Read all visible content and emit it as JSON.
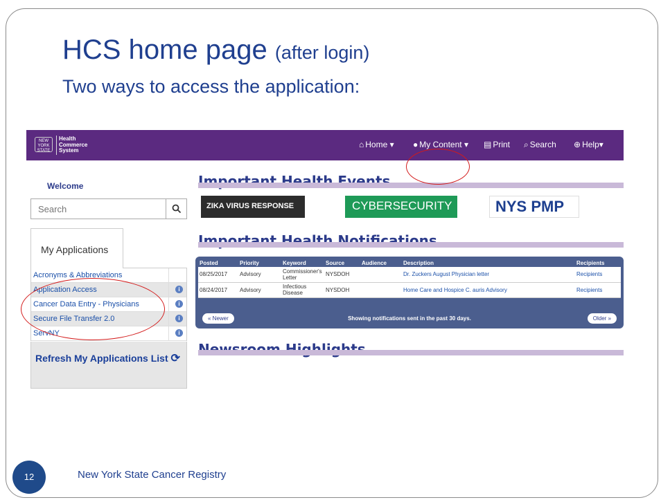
{
  "slide": {
    "title": "HCS home page",
    "title_suffix": "(after login)",
    "subtitle": "Two ways to access the application:",
    "page_number": "12",
    "footer": "New York State Cancer Registry"
  },
  "hcs": {
    "logo_state": "NEW YORK STATE",
    "logo_lines": [
      "Health",
      "Commerce",
      "System"
    ],
    "nav": {
      "home": "Home",
      "my_content": "My Content",
      "print": "Print",
      "search": "Search",
      "help": "Help"
    },
    "welcome": "Welcome",
    "search_placeholder": "Search",
    "apps_tab": "My Applications",
    "apps": [
      "Acronyms & Abbreviations",
      "Application Access",
      "Cancer Data Entry - Physicians",
      "Secure File Transfer 2.0",
      "ServNY"
    ],
    "refresh": "Refresh My Applications List",
    "events_head": "Important Health Events",
    "banners": {
      "zika": "ZIKA VIRUS RESPONSE",
      "cyber": "CYBERSECURITY",
      "pmp": "NYS PMP"
    },
    "notifications_head": "Important Health Notifications",
    "table": {
      "headers": [
        "Posted",
        "Priority",
        "Keyword",
        "Source",
        "Audience",
        "Description",
        "Recipients"
      ],
      "rows": [
        [
          "08/25/2017",
          "Advisory",
          "Commissioner's Letter",
          "NYSDOH",
          "",
          "Dr. Zuckers August Physician letter",
          "Recipients"
        ],
        [
          "08/24/2017",
          "Advisory",
          "Infectious Disease",
          "NYSDOH",
          "",
          "Home Care and Hospice C. auris Advisory",
          "Recipients"
        ]
      ]
    },
    "newer": "« Newer",
    "older": "Older »",
    "notif_note": "Showing notifications sent in the past 30 days.",
    "newsroom_head": "Newsroom Highlights..."
  },
  "colors": {
    "topbar": "#5b2a80",
    "title_blue": "#1f3f8f",
    "annotation_red": "#d31a1a"
  }
}
